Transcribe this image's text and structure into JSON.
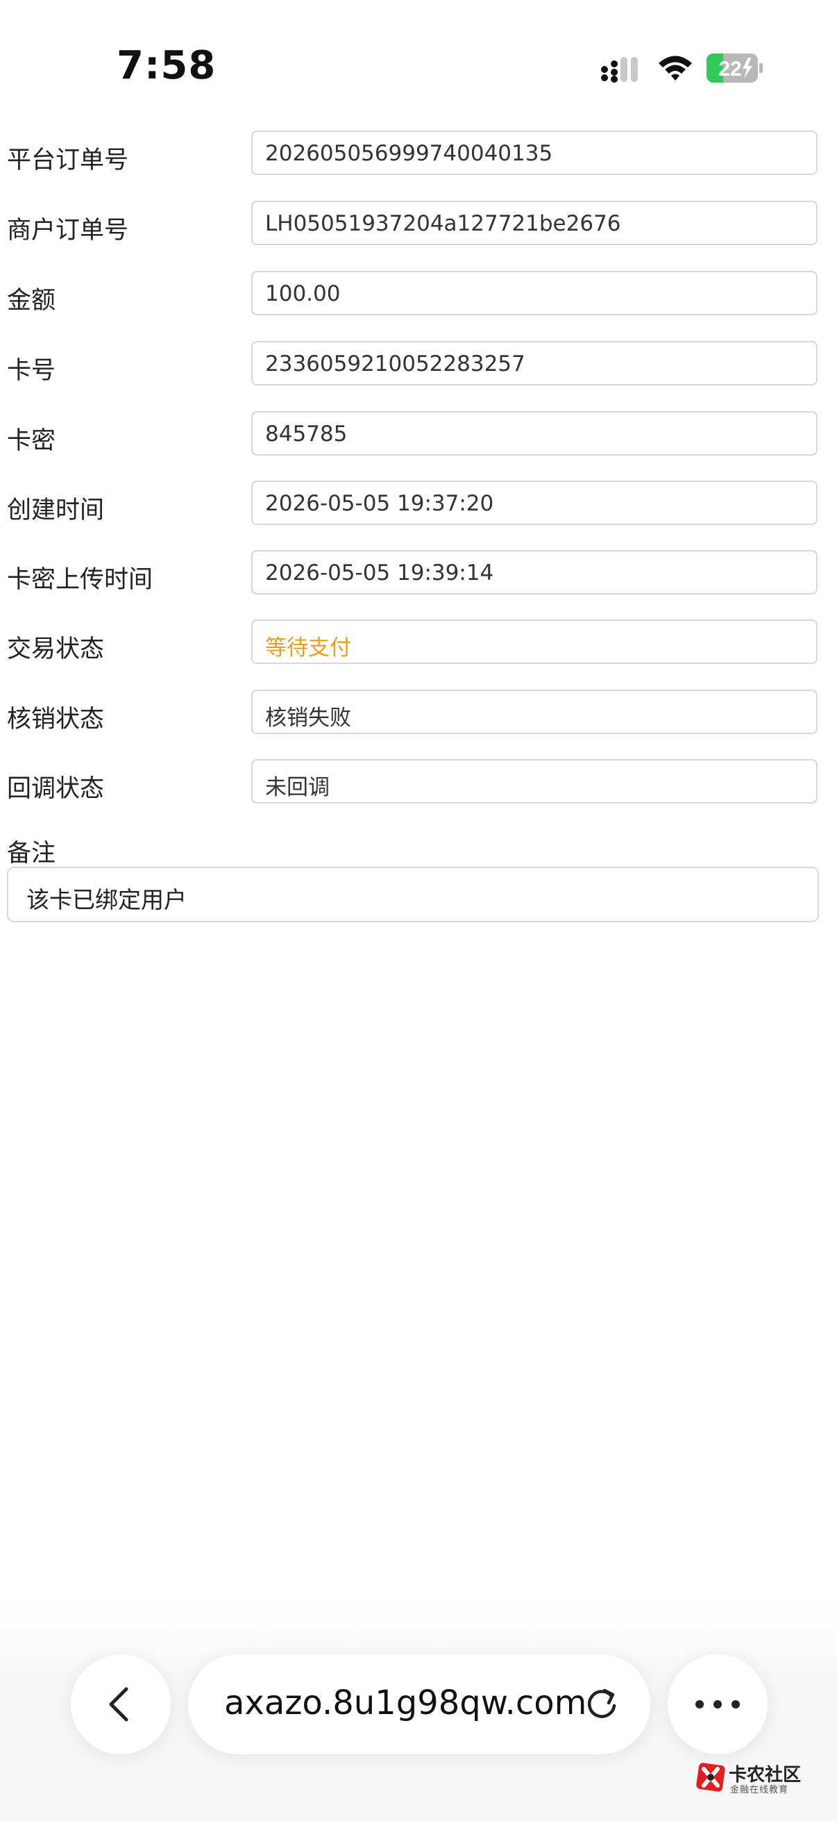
{
  "status_bar": {
    "time": "7:58",
    "battery_level": "22"
  },
  "fields": [
    {
      "label": "平台订单号",
      "value": "20260505699974004013​5"
    },
    {
      "label": "商户订单号",
      "value": "LH05051937204a127721be2676"
    },
    {
      "label": "金额",
      "value": "100.00"
    },
    {
      "label": "卡号",
      "value": "2336059210052283257"
    },
    {
      "label": "卡密",
      "value": "845785"
    },
    {
      "label": "创建时间",
      "value": "2026-05-05 19:37:20"
    },
    {
      "label": "卡密上传时间",
      "value": "2026-05-05 19:39:14"
    },
    {
      "label": "交易状态",
      "value": "等待支付"
    },
    {
      "label": "核销状态",
      "value": "核销失败"
    },
    {
      "label": "回调状态",
      "value": "未回调"
    }
  ],
  "remark": {
    "label": "备注",
    "value": "该卡已绑定用户"
  },
  "browser": {
    "url": "axazo.8u1g98qw.com"
  },
  "watermark": {
    "title": "卡农社区",
    "subtitle": "金融在线教育"
  },
  "colors": {
    "pending_status": "#e5a020",
    "battery_green": "#34c759"
  }
}
